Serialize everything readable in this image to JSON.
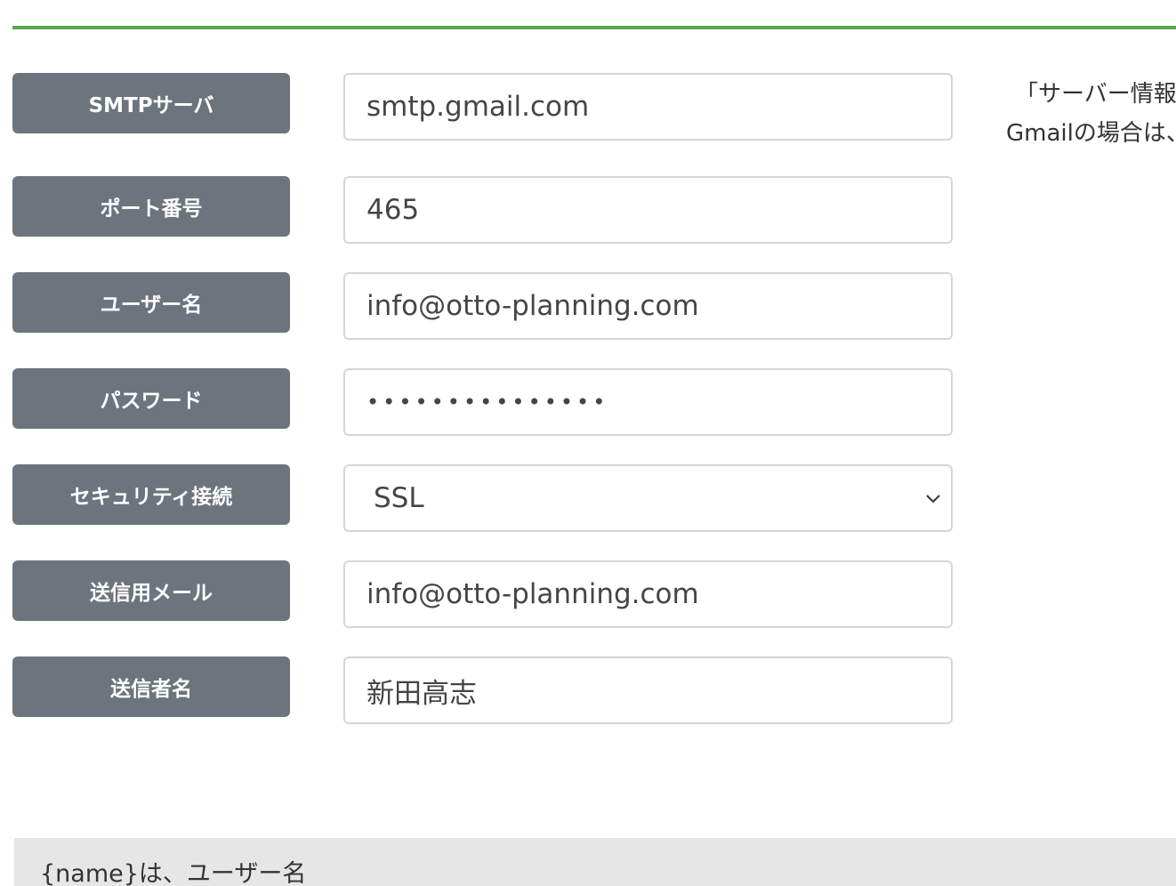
{
  "form": {
    "smtp_server": {
      "label": "SMTPサーバ",
      "value": "smtp.gmail.com"
    },
    "port": {
      "label": "ポート番号",
      "value": "465"
    },
    "username": {
      "label": "ユーザー名",
      "value": "info@otto-planning.com"
    },
    "password": {
      "label": "パスワード",
      "value": "•••••••••••••••"
    },
    "security": {
      "label": "セキュリティ接続",
      "value": "SSL",
      "icon": "chevron-down-icon"
    },
    "sender_email": {
      "label": "送信用メール",
      "value": "info@otto-planning.com"
    },
    "sender_name": {
      "label": "送信者名",
      "value": "新田高志"
    }
  },
  "side_note": {
    "line1": "「サーバー情報",
    "line2": "Gmailの場合は、"
  },
  "bottom_panel": {
    "text": "{name}は、ユーザー名"
  },
  "colors": {
    "accent_rule": "#5aa350",
    "label_bg": "#6c757d",
    "panel_bg": "#e6e6e6"
  }
}
